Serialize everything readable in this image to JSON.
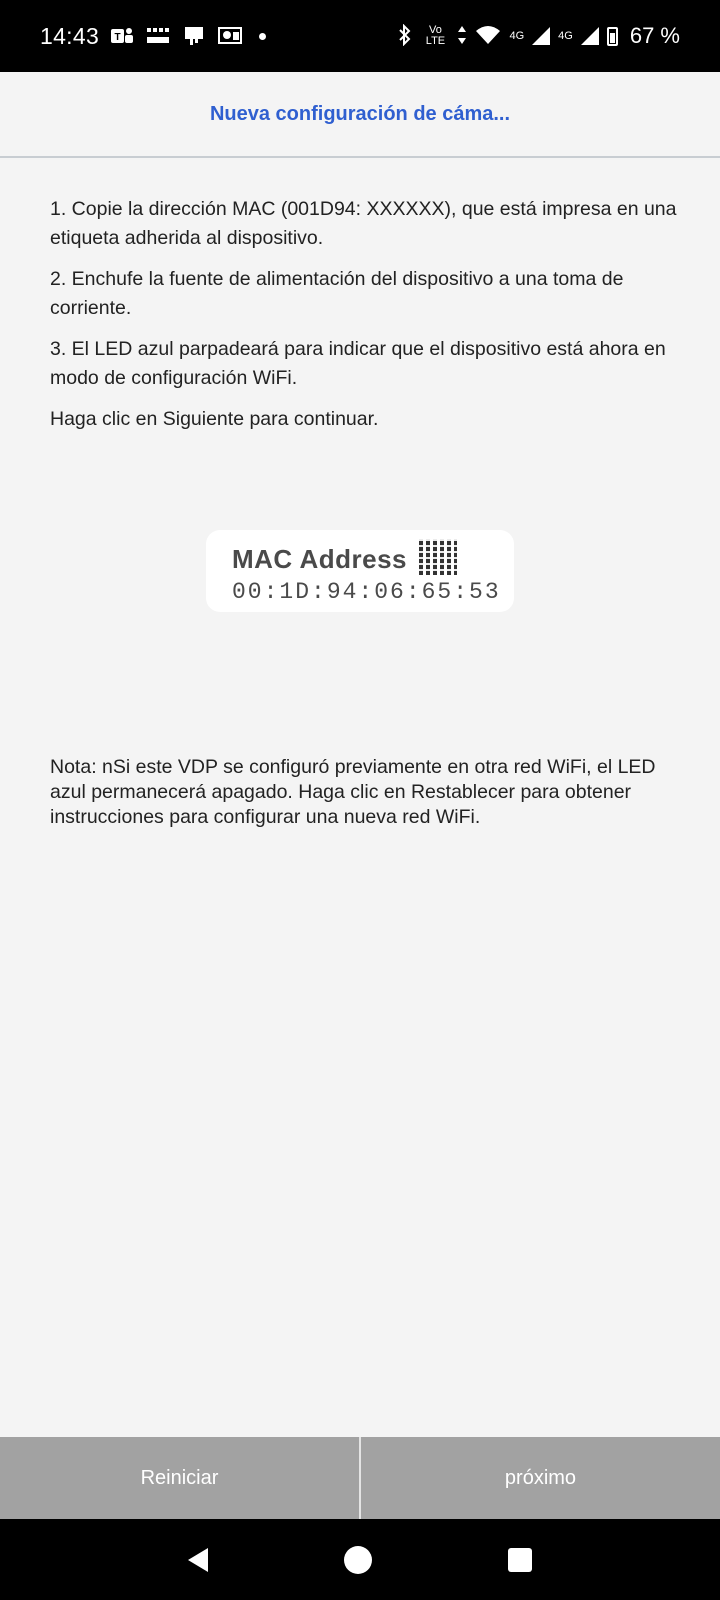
{
  "status_bar": {
    "time": "14:43",
    "notification_icons": [
      "teams-icon",
      "temu-icon",
      "device-icon",
      "camera-icon"
    ],
    "right_labels": {
      "vo_lte": "Vo LTE",
      "net1": "4G",
      "net2": "4G"
    },
    "battery": "67 %"
  },
  "header": {
    "title": "Nueva configuración de cáma..."
  },
  "instructions": [
    "1. Copie la dirección MAC (001D94: XXXXXX), que está impresa en una etiqueta adherida al dispositivo.",
    "2. Enchufe la fuente de alimentación del dispositivo a una toma de corriente.",
    "3. El LED azul parpadeará para indicar que el dispositivo está ahora en modo de configuración WiFi.",
    "Haga clic en Siguiente para continuar."
  ],
  "mac_card": {
    "title": "MAC Address",
    "value": "00:1D:94:06:65:53"
  },
  "note": "Nota:  nSi este VDP se configuró previamente en otra red WiFi, el LED azul permanecerá apagado. Haga clic en Restablecer para obtener instrucciones para configurar una nueva red WiFi.",
  "buttons": {
    "reset": "Reiniciar",
    "next": "próximo"
  }
}
